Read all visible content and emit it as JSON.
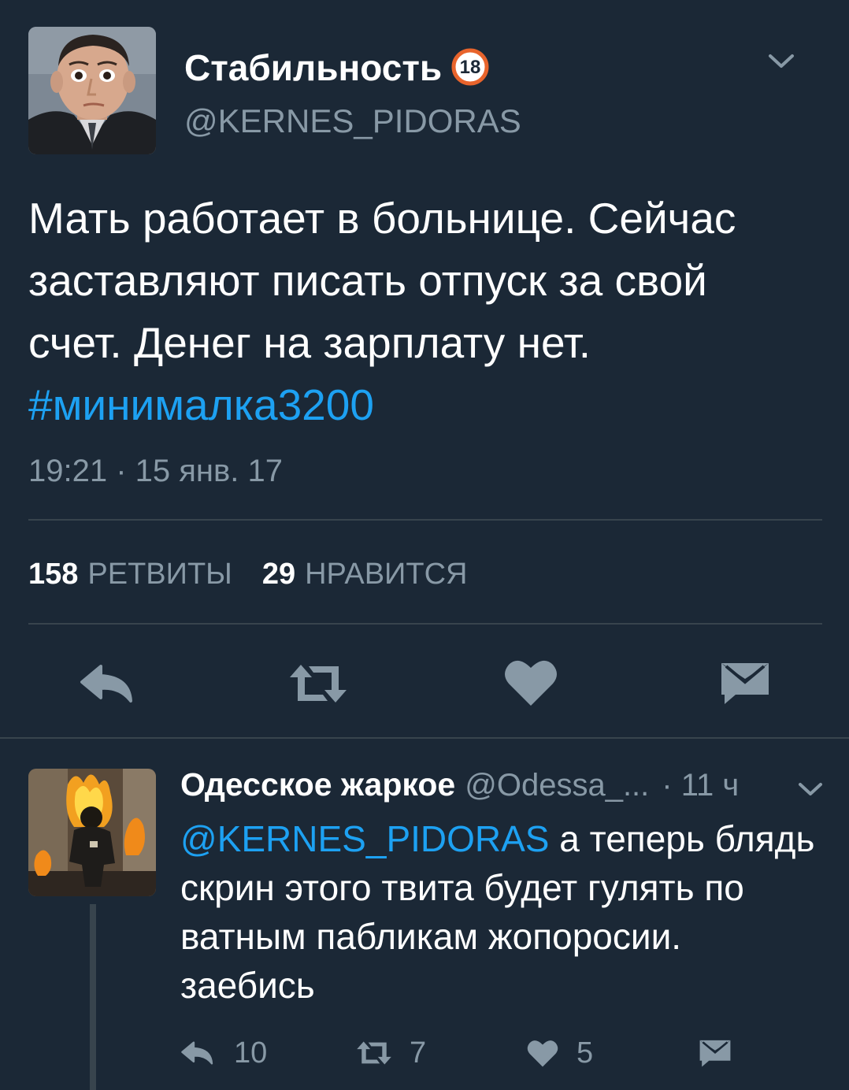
{
  "tweet": {
    "display_name": "Стабильность",
    "badge_text": "18",
    "handle": "@KERNES_PIDORAS",
    "text_line1": "Мать работает в больнице. Сейчас",
    "text_line2": "заставляют писать отпуск за свой",
    "text_line3": "счет. Денег на зарплату нет.",
    "hashtag": "#минималка3200",
    "timestamp": "19:21 · 15 янв. 17",
    "retweets_count": "158",
    "retweets_label": "РЕТВИТЫ",
    "likes_count": "29",
    "likes_label": "НРАВИТСЯ",
    "icons": {
      "reply": "reply-icon",
      "retweet": "retweet-icon",
      "like": "heart-icon",
      "dm": "envelope-icon",
      "menu": "chevron-down-icon"
    }
  },
  "reply": {
    "display_name": "Одесское жаркое",
    "handle": "@Odessa_...",
    "time": "· 11 ч",
    "mention": "@KERNES_PIDORAS",
    "text_line1_rest": " а теперь блядь",
    "text_line2": "скрин этого твита будет гулять по",
    "text_line3": "ватным пабликам жопоросии.",
    "text_line4": "заебись",
    "reply_count": "10",
    "retweet_count": "7",
    "like_count": "5"
  },
  "colors": {
    "background": "#1b2836",
    "text_primary": "#ffffff",
    "text_secondary": "#8899a6",
    "link": "#1da1f2",
    "divider": "#38444d",
    "badge_ring": "#e8642c"
  }
}
